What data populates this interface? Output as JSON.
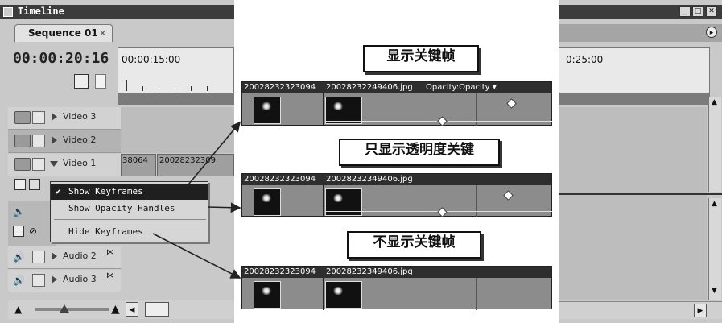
{
  "left_panel": {
    "window_title": "Timeline",
    "tab_label": "Sequence 01",
    "timecode": "00:00:20:16",
    "ruler_time": "00:00:15:00",
    "clip_label_a": "38064",
    "clip_label_b": "20028232309",
    "tracks": [
      {
        "label": "Video 3",
        "expanded": false
      },
      {
        "label": "Video 2",
        "expanded": false
      },
      {
        "label": "Video 1",
        "expanded": true
      },
      {
        "label": "Audio 2",
        "expanded": false
      },
      {
        "label": "Audio 3",
        "expanded": false
      }
    ],
    "context_menu": [
      {
        "label": "Show Keyframes",
        "checked": true
      },
      {
        "label": "Show Opacity Handles",
        "checked": false
      },
      {
        "label": "Hide Keyframes",
        "checked": false
      }
    ]
  },
  "center": {
    "captions": [
      "显示关键帧",
      "只显示透明度关键",
      "不显示关键帧"
    ],
    "strips": [
      {
        "clip_a": "20028232323094",
        "clip_b": "20028232249406.jpg",
        "effect": "Opacity:Opacity"
      },
      {
        "clip_a": "20028232323094",
        "clip_b": "20028232349406.jpg",
        "effect": ""
      },
      {
        "clip_a": "20028232323094",
        "clip_b": "20028232349406.jpg",
        "effect": ""
      }
    ]
  },
  "right_panel": {
    "ruler_time": "0:25:00",
    "window_buttons": [
      "minimize",
      "maximize",
      "close"
    ]
  }
}
